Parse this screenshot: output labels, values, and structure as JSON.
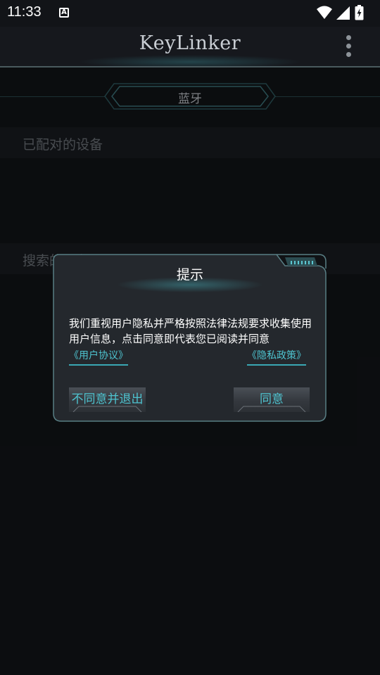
{
  "status_bar": {
    "time": "11:33",
    "notification_icon_letter": "A",
    "icons": [
      "wifi-icon",
      "signal-icon",
      "battery-charging-icon"
    ]
  },
  "app_bar": {
    "title": "KeyLinker",
    "menu_icon": "more-vert-icon"
  },
  "tab": {
    "label": "蓝牙"
  },
  "sections": {
    "paired_label": "已配对的设备",
    "search_label": "搜索的设备"
  },
  "dialog": {
    "title": "提示",
    "message": "我们重视用户隐私并严格按照法律法规要求收集使用用户信息，点击同意即代表您已阅读并同意",
    "link_user_agreement": "《用户协议》",
    "link_privacy_policy": "《隐私政策》",
    "decline_label": "不同意并退出",
    "agree_label": "同意"
  },
  "colors": {
    "background": "#121418",
    "accent": "#4ec3cf",
    "dialog_bg": "#23272c",
    "dialog_border": "#5b8a90"
  }
}
